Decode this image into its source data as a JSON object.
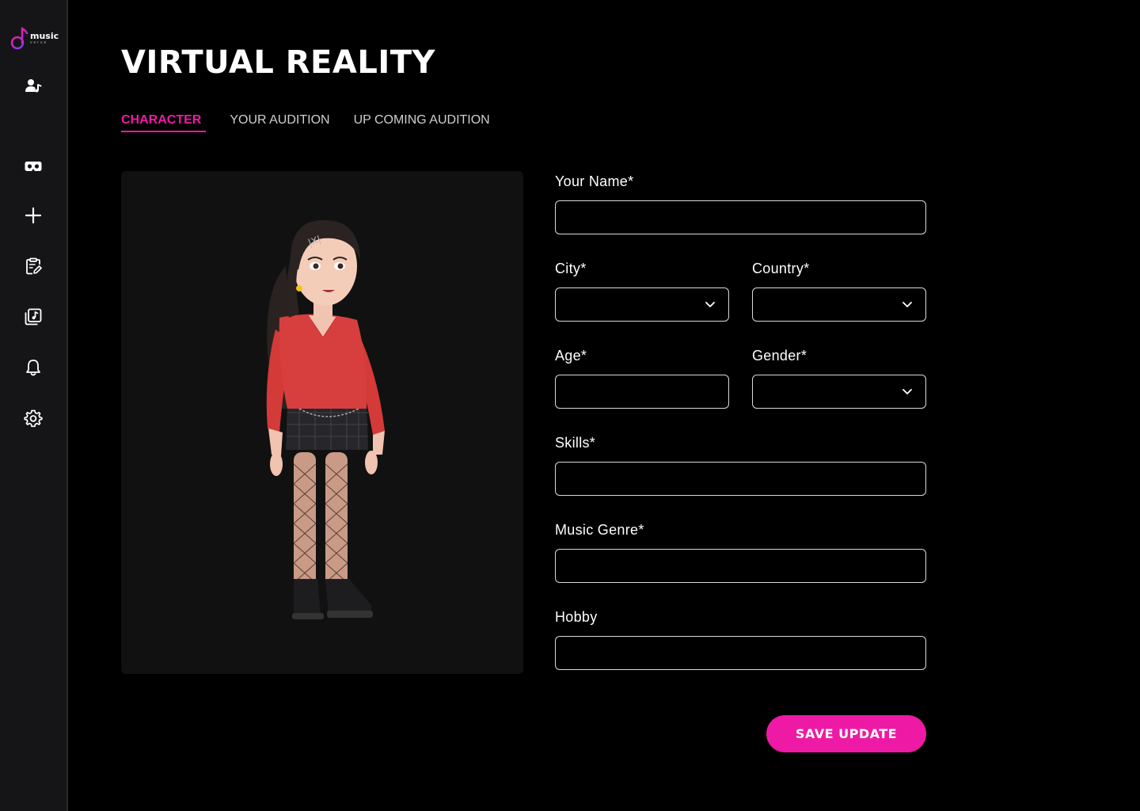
{
  "brand": {
    "name": "music",
    "sub": "verse"
  },
  "sidebar": {
    "items": [
      {
        "icon": "user-music-icon"
      },
      {
        "icon": "vr-headset-icon"
      },
      {
        "icon": "plus-icon"
      },
      {
        "icon": "clipboard-edit-icon"
      },
      {
        "icon": "music-library-icon"
      },
      {
        "icon": "bell-icon"
      },
      {
        "icon": "gear-icon"
      }
    ]
  },
  "page": {
    "title": "VIRTUAL REALITY"
  },
  "tabs": [
    {
      "label": "CHARACTER",
      "active": true
    },
    {
      "label": "YOUR AUDITION",
      "active": false
    },
    {
      "label": "UP COMING AUDITION",
      "active": false
    }
  ],
  "form": {
    "name": {
      "label": "Your Name*",
      "value": ""
    },
    "city": {
      "label": "City*",
      "value": ""
    },
    "country": {
      "label": "Country*",
      "value": ""
    },
    "age": {
      "label": "Age*",
      "value": ""
    },
    "gender": {
      "label": "Gender*",
      "value": ""
    },
    "skills": {
      "label": "Skills*",
      "value": ""
    },
    "genre": {
      "label": "Music Genre*",
      "value": ""
    },
    "hobby": {
      "label": "Hobby",
      "value": ""
    },
    "save_label": "SAVE UPDATE"
  },
  "colors": {
    "accent": "#ee1aa5",
    "sidebar": "#151517",
    "panel": "#111112",
    "background": "#000000"
  }
}
